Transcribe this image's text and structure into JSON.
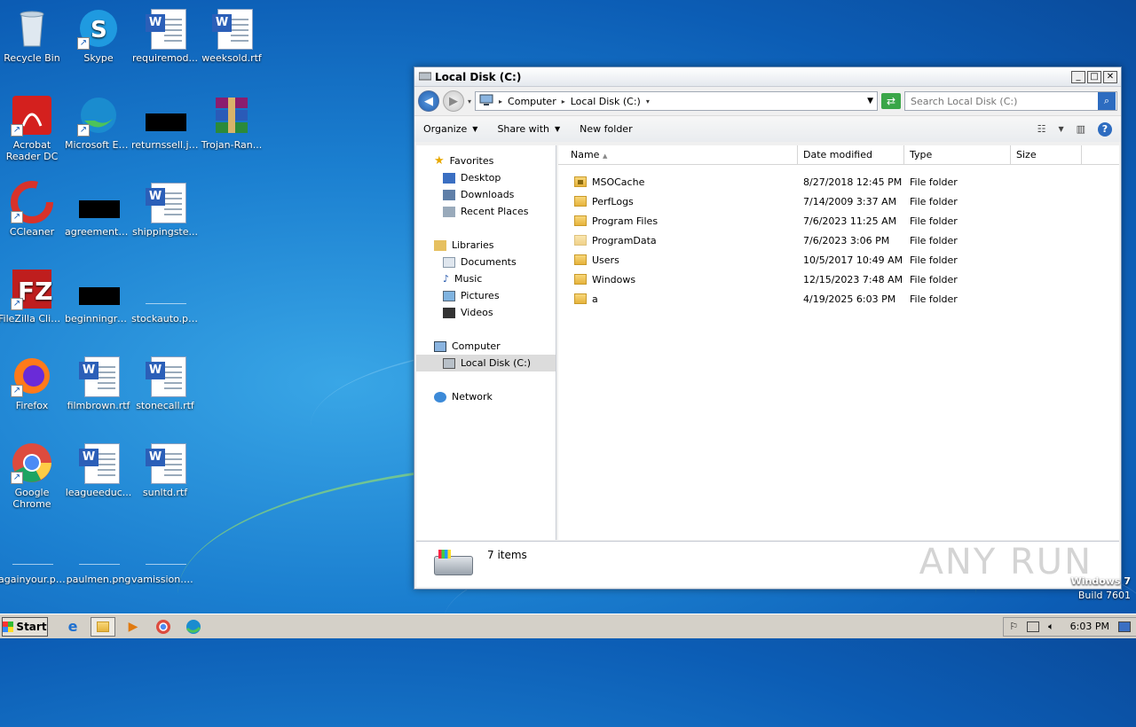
{
  "desktop": {
    "icons": [
      {
        "label": "Recycle Bin",
        "icon": "recycle-bin-icon"
      },
      {
        "label": "Skype",
        "icon": "skype-icon"
      },
      {
        "label": "requiremod...",
        "icon": "word-doc-icon"
      },
      {
        "label": "weeksold.rtf",
        "icon": "word-doc-icon"
      },
      {
        "label": "Acrobat Reader DC",
        "icon": "acrobat-icon"
      },
      {
        "label": "Microsoft Edge",
        "icon": "edge-icon"
      },
      {
        "label": "returnssell.jpg",
        "icon": "image-redacted-icon"
      },
      {
        "label": "Trojan-Ran...",
        "icon": "winrar-icon"
      },
      {
        "label": "CCleaner",
        "icon": "ccleaner-icon"
      },
      {
        "label": "agreementc...",
        "icon": "image-redacted-icon"
      },
      {
        "label": "shippingste...",
        "icon": "word-doc-icon"
      },
      {
        "label": "FileZilla Client",
        "icon": "filezilla-icon"
      },
      {
        "label": "beginningre...",
        "icon": "image-redacted-icon"
      },
      {
        "label": "stockauto.png",
        "icon": "image-icon"
      },
      {
        "label": "Firefox",
        "icon": "firefox-icon"
      },
      {
        "label": "filmbrown.rtf",
        "icon": "word-doc-icon"
      },
      {
        "label": "stonecall.rtf",
        "icon": "word-doc-icon"
      },
      {
        "label": "Google Chrome",
        "icon": "chrome-icon"
      },
      {
        "label": "leagueeduc...",
        "icon": "word-doc-icon"
      },
      {
        "label": "sunltd.rtf",
        "icon": "word-doc-icon"
      },
      {
        "label": "againyour.png",
        "icon": "image-icon"
      },
      {
        "label": "paulmen.png",
        "icon": "image-icon"
      },
      {
        "label": "vamission.png",
        "icon": "image-icon"
      }
    ]
  },
  "window": {
    "title": "Local Disk (C:)",
    "breadcrumb": [
      "Computer",
      "Local Disk (C:)"
    ],
    "search_placeholder": "Search Local Disk (C:)",
    "toolbar": {
      "organize": "Organize",
      "share_with": "Share with",
      "new_folder": "New folder"
    },
    "nav": {
      "favorites": "Favorites",
      "desktop": "Desktop",
      "downloads": "Downloads",
      "recent_places": "Recent Places",
      "libraries": "Libraries",
      "documents": "Documents",
      "music": "Music",
      "pictures": "Pictures",
      "videos": "Videos",
      "computer": "Computer",
      "local_disk": "Local Disk (C:)",
      "network": "Network"
    },
    "columns": {
      "name": "Name",
      "date_modified": "Date modified",
      "type": "Type",
      "size": "Size"
    },
    "files": [
      {
        "name": "MSOCache",
        "date": "8/27/2018 12:45 PM",
        "type": "File folder"
      },
      {
        "name": "PerfLogs",
        "date": "7/14/2009 3:37 AM",
        "type": "File folder"
      },
      {
        "name": "Program Files",
        "date": "7/6/2023 11:25 AM",
        "type": "File folder"
      },
      {
        "name": "ProgramData",
        "date": "7/6/2023 3:06 PM",
        "type": "File folder"
      },
      {
        "name": "Users",
        "date": "10/5/2017 10:49 AM",
        "type": "File folder"
      },
      {
        "name": "Windows",
        "date": "12/15/2023 7:48 AM",
        "type": "File folder"
      },
      {
        "name": "a",
        "date": "4/19/2025 6:03 PM",
        "type": "File folder"
      }
    ],
    "status": {
      "item_count": "7 items"
    },
    "watermark": "ANY RUN"
  },
  "windows_version": {
    "line1": "Windows 7",
    "line2": "Build 7601"
  },
  "taskbar": {
    "start_label": "Start",
    "clock": "6:03 PM"
  }
}
